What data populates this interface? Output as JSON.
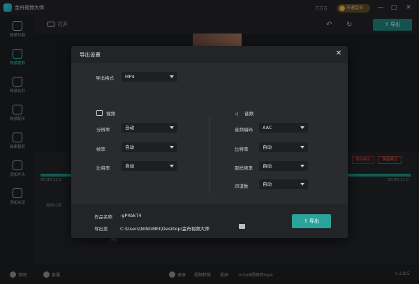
{
  "titlebar": {
    "title": "金舟视频大师",
    "username": "方方方",
    "vip_label": "开通会员",
    "min": "—",
    "restore": "□",
    "close": "✕"
  },
  "sidebar": {
    "items": [
      {
        "label": "视频分割",
        "icon": "split-icon"
      },
      {
        "label": "视频提取",
        "icon": "extract-icon",
        "active": true
      },
      {
        "label": "视频合并",
        "icon": "merge-icon"
      },
      {
        "label": "视频配乐",
        "icon": "music-icon"
      },
      {
        "label": "画面裁剪",
        "icon": "crop-icon"
      },
      {
        "label": "添加片头",
        "icon": "intro-icon"
      },
      {
        "label": "添加水印",
        "icon": "watermark-icon"
      }
    ]
  },
  "toolbar": {
    "open_label": "打开",
    "export_label": "导出"
  },
  "background": {
    "time_start": "00:00:11.0",
    "time_end": "00:00:11.0",
    "mode1": "删除模式",
    "mode2": "保留模式",
    "track_label": "视频片段",
    "check_label": "静音"
  },
  "dialog": {
    "title": "导出设置",
    "format": {
      "label": "导出格式",
      "value": "MP4"
    },
    "video": {
      "title": "视频",
      "rows": [
        {
          "label": "分辨率",
          "value": "自动"
        },
        {
          "label": "帧率",
          "value": "自动"
        },
        {
          "label": "比特率",
          "value": "自动"
        }
      ]
    },
    "audio": {
      "title": "音频",
      "rows": [
        {
          "label": "音频编码",
          "value": "AAC"
        },
        {
          "label": "比特率",
          "value": "自动"
        },
        {
          "label": "取样频率",
          "value": "自动"
        },
        {
          "label": "声道数",
          "value": "自动"
        }
      ]
    },
    "name": {
      "label": "作品名称",
      "value": "-gP4bkT4"
    },
    "path": {
      "label": "导出至",
      "value": "C:\\Users\\NINGMEI\\Desktop\\金舟视频大师"
    },
    "export_label": "导出"
  },
  "statusbar": {
    "website": "官网",
    "service": "客服",
    "record": "录屏",
    "convert": "视频转换",
    "screenshot": "投屏",
    "tool": "m3u8视频转mp4",
    "version": "v 2.8.5"
  }
}
